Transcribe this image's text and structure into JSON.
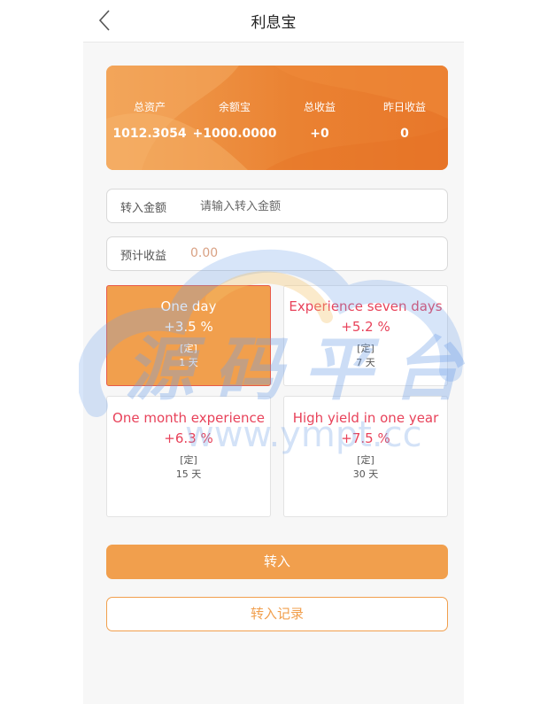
{
  "header": {
    "title": "利息宝",
    "back_icon": "chevron-left-icon"
  },
  "summary": {
    "stats": [
      {
        "label": "总资产",
        "value": "1012.3054"
      },
      {
        "label": "余额宝",
        "value": "+1000.0000"
      },
      {
        "label": "总收益",
        "value": "+0"
      },
      {
        "label": "昨日收益",
        "value": "0"
      }
    ]
  },
  "transfer_amount": {
    "label": "转入金额",
    "placeholder": "请输入转入金额",
    "value": ""
  },
  "expected_income": {
    "label": "预计收益",
    "value": "0.00"
  },
  "plans": [
    {
      "name": "One day",
      "rate": "+3.5 %",
      "type": "[定]",
      "days": "1 天",
      "selected": true
    },
    {
      "name": "Experience seven days",
      "rate": "+5.2 %",
      "type": "[定]",
      "days": "7 天",
      "selected": false
    },
    {
      "name": "One month experience",
      "rate": "+6.3 %",
      "type": "[定]",
      "days": "15 天",
      "selected": false
    },
    {
      "name": "High yield in one year",
      "rate": "+7.5 %",
      "type": "[定]",
      "days": "30 天",
      "selected": false
    }
  ],
  "buttons": {
    "transfer_in": "转入",
    "transfer_records": "转入记录"
  },
  "watermark": {
    "text": "源码平台",
    "url": "www.ympt.cc"
  },
  "colors": {
    "accent_orange": "#f19f4d",
    "card_gradient_start": "#f1a052",
    "card_gradient_end": "#e8772a",
    "plan_text_red": "#e8425a",
    "selected_border": "#e85a48"
  }
}
